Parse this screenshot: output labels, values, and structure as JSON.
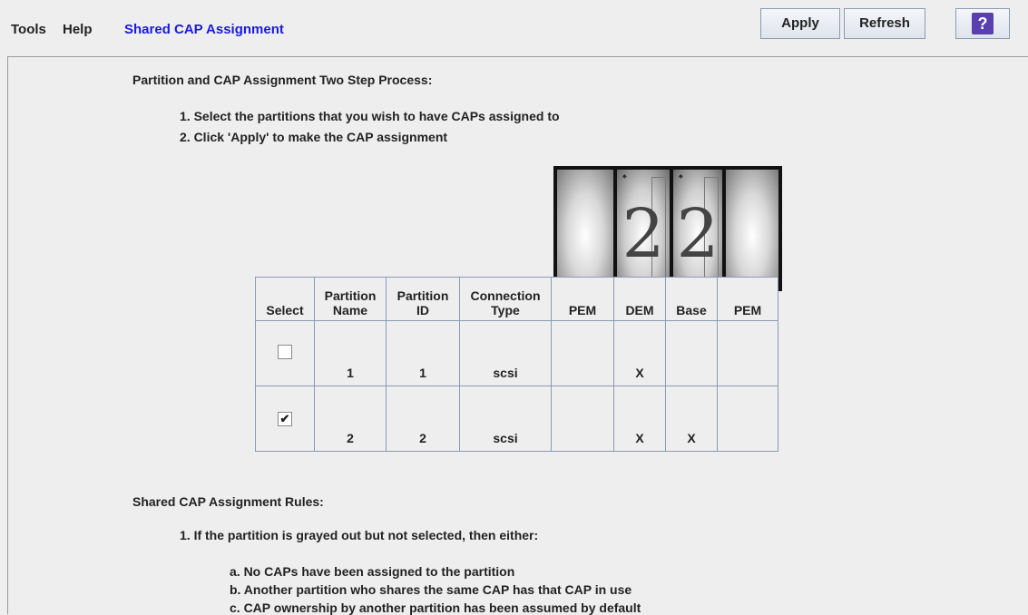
{
  "menu": {
    "tools": "Tools",
    "help": "Help",
    "title": "Shared CAP Assignment"
  },
  "toolbar": {
    "apply": "Apply",
    "refresh": "Refresh",
    "help_icon": "?"
  },
  "heading": "Partition and CAP Assignment Two Step Process:",
  "steps": [
    "1. Select the partitions that you wish to have CAPs assigned to",
    "2. Click 'Apply' to make the CAP assignment"
  ],
  "library": {
    "module_number": "2"
  },
  "table": {
    "headers": {
      "select": "Select",
      "partition_name": [
        "Partition",
        "Name"
      ],
      "partition_id": [
        "Partition",
        "ID"
      ],
      "connection_type": [
        "Connection",
        "Type"
      ],
      "pem1": "PEM",
      "dem": "DEM",
      "base": "Base",
      "pem2": "PEM"
    },
    "rows": [
      {
        "checked": false,
        "check_glyph": "",
        "name": "1",
        "id": "1",
        "type": "scsi",
        "pem1": "",
        "dem": "X",
        "base": "",
        "pem2": ""
      },
      {
        "checked": true,
        "check_glyph": "✔",
        "name": "2",
        "id": "2",
        "type": "scsi",
        "pem1": "",
        "dem": "X",
        "base": "X",
        "pem2": ""
      }
    ]
  },
  "rules": {
    "heading": "Shared CAP Assignment Rules:",
    "rule1": "1. If the partition is grayed out but not selected, then either:",
    "sub": [
      "a. No CAPs have been assigned to the partition",
      "b. Another partition who shares the same CAP has that CAP in use",
      "c. CAP ownership by another partition has been assumed by default"
    ]
  },
  "colors": {
    "title_link": "#1a1ae0",
    "help_icon_bg": "#5a3fb0",
    "table_border": "#8a9bb5"
  }
}
